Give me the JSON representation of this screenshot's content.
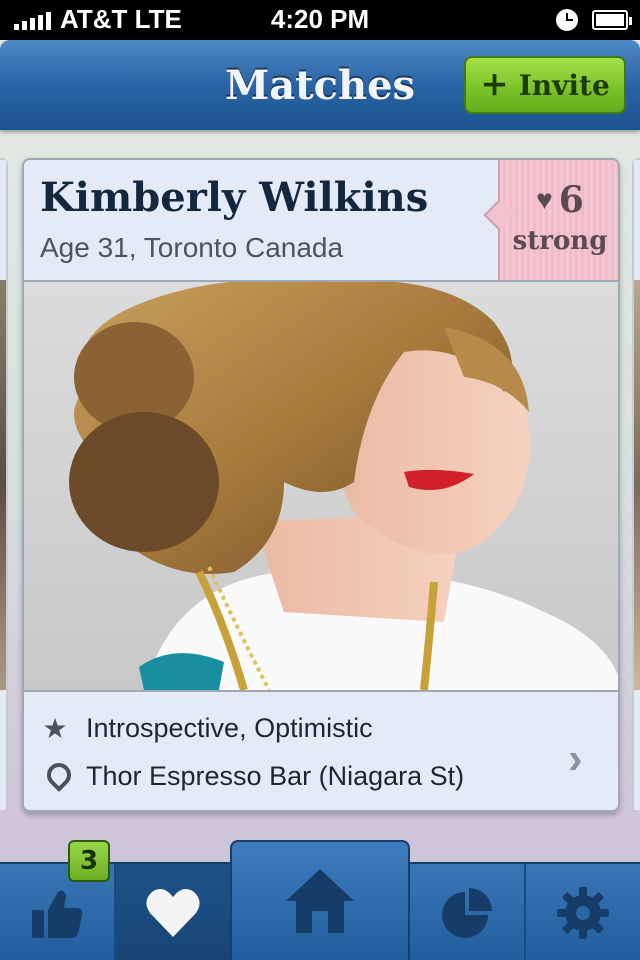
{
  "status_bar": {
    "carrier": "AT&T  LTE",
    "time": "4:20 PM"
  },
  "nav": {
    "title": "Matches",
    "invite_label": "Invite"
  },
  "match": {
    "name": "Kimberly Wilkins",
    "details": "Age 31, Toronto Canada",
    "strength_count": "6",
    "strength_label": "strong",
    "traits": "Introspective, Optimistic",
    "place": "Thor Espresso Bar (Niagara St)"
  },
  "tab_bar": {
    "likes_badge": "3",
    "tabs": [
      {
        "name": "likes",
        "icon": "thumbs-up-icon"
      },
      {
        "name": "favorites",
        "icon": "heart-icon"
      },
      {
        "name": "home",
        "icon": "home-icon"
      },
      {
        "name": "stats",
        "icon": "pie-chart-icon"
      },
      {
        "name": "settings",
        "icon": "gear-icon"
      }
    ]
  },
  "colors": {
    "nav_blue": "#2a64a4",
    "invite_green": "#7cc42a",
    "strength_pink": "#f5c6d2",
    "card_bg": "#e4ebf6"
  }
}
